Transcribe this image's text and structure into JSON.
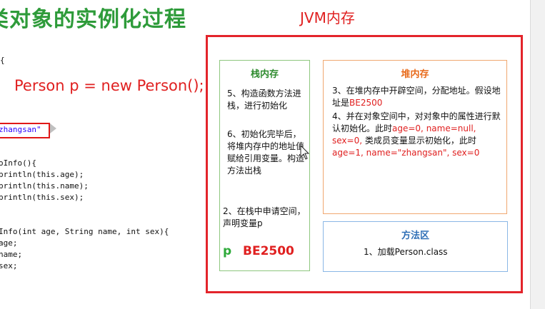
{
  "slide": {
    "title": "类对象的实例化过程",
    "statement": "Person p = new Person();",
    "title_color": "#2e9b3a",
    "accent_red": "#e02020"
  },
  "code": {
    "lines": [
      {
        "text": "{"
      },
      {
        "text": "zhangsan\""
      },
      {
        "text": "oInfo(){"
      },
      {
        "text": "println(this.age);"
      },
      {
        "text": "println(this.name);"
      },
      {
        "text": "println(this.sex);"
      },
      {
        "text": "Info(int age, String name, int sex){"
      },
      {
        "text": "age;"
      },
      {
        "text": "name;"
      },
      {
        "text": "sex;"
      }
    ]
  },
  "jvm": {
    "title": "JVM内存",
    "stack": {
      "title": "栈内存",
      "step5": "5、构造函数方法进栈，进行初始化",
      "step6": "6、初始化完毕后，将堆内存中的地址值赋给引用变量。构造方法出栈",
      "step2": "2、在栈中申请空间，声明变量p",
      "var_name": "p",
      "var_value": "BE2500"
    },
    "heap": {
      "title": "堆内存",
      "step3_a": "3、在堆内存中开辟空间，分配地址。假设地址是",
      "step3_addr": "BE2500",
      "step4_a": "4、并在对象空间中，对对象中的属性进行默认初始化。此时",
      "step4_b": "age=0, name=null, sex=0,",
      "step4_c": " 类成员变量显示初始化，此时",
      "step4_d": "age=1, name=\"zhangsan\", sex=0"
    },
    "method_area": {
      "title": "方法区",
      "step1": "1、加载Person.class"
    }
  }
}
